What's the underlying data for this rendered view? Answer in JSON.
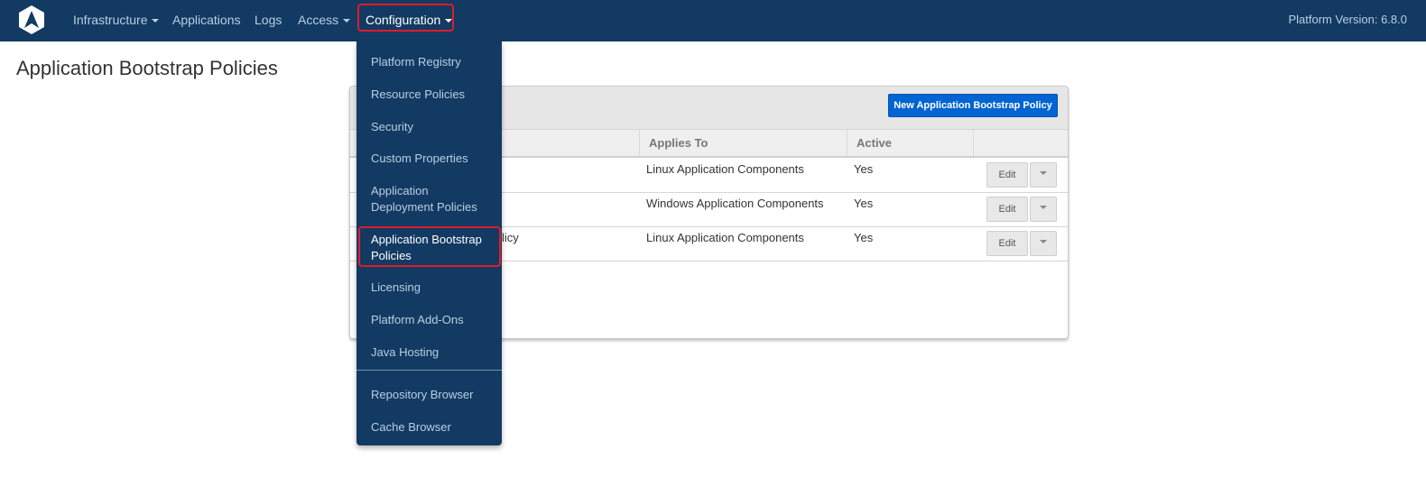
{
  "navbar": {
    "logo_icon": "platform-logo-icon",
    "items": [
      {
        "label": "Infrastructure",
        "has_caret": true
      },
      {
        "label": "Applications",
        "has_caret": false
      },
      {
        "label": "Logs",
        "has_caret": false
      },
      {
        "label": "Access",
        "has_caret": true
      },
      {
        "label": "Configuration",
        "has_caret": true
      }
    ],
    "version": "Platform Version: 6.8.0"
  },
  "page": {
    "title": "Application Bootstrap Policies"
  },
  "panel": {
    "new_button": "New Application Bootstrap Policy",
    "columns": [
      "",
      "Applies To",
      "Active",
      ""
    ],
    "rows": [
      {
        "name": "",
        "applies_to": "Linux Application Components",
        "active": "Yes",
        "edit": "Edit"
      },
      {
        "name": "",
        "applies_to": "Windows Application Components",
        "active": "Yes",
        "edit": "Edit"
      },
      {
        "name": "licy",
        "applies_to": "Linux Application Components",
        "active": "Yes",
        "edit": "Edit"
      }
    ]
  },
  "dropdown": {
    "items": [
      "Platform Registry",
      "Resource Policies",
      "Security",
      "Custom Properties",
      "Application Deployment Policies",
      "Application Bootstrap Policies",
      "Licensing",
      "Platform Add-Ons",
      "Java Hosting",
      "Repository Browser",
      "Cache Browser"
    ],
    "active_item": "Application Bootstrap Policies"
  },
  "colors": {
    "navbar_bg": "#123a62",
    "highlight": "#e01b2a",
    "primary_button": "#0064d2"
  }
}
